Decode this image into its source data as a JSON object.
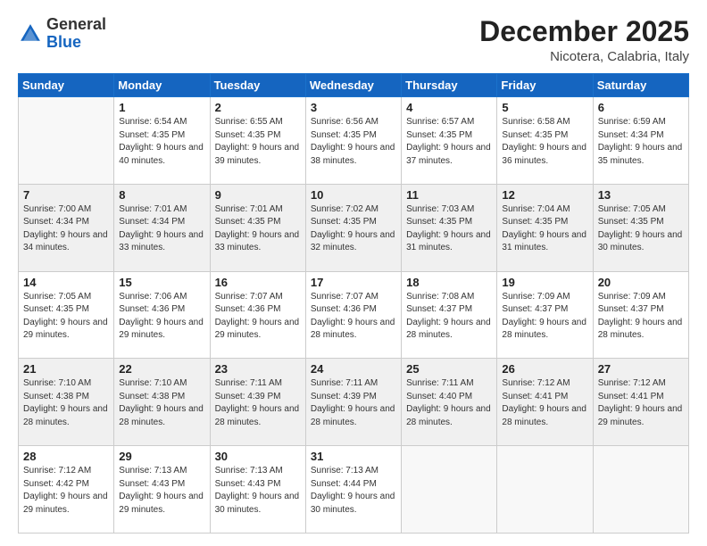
{
  "header": {
    "logo_general": "General",
    "logo_blue": "Blue",
    "month_title": "December 2025",
    "location": "Nicotera, Calabria, Italy"
  },
  "weekdays": [
    "Sunday",
    "Monday",
    "Tuesday",
    "Wednesday",
    "Thursday",
    "Friday",
    "Saturday"
  ],
  "weeks": [
    [
      {
        "day": "",
        "sunrise": "",
        "sunset": "",
        "daylight": ""
      },
      {
        "day": "1",
        "sunrise": "Sunrise: 6:54 AM",
        "sunset": "Sunset: 4:35 PM",
        "daylight": "Daylight: 9 hours and 40 minutes."
      },
      {
        "day": "2",
        "sunrise": "Sunrise: 6:55 AM",
        "sunset": "Sunset: 4:35 PM",
        "daylight": "Daylight: 9 hours and 39 minutes."
      },
      {
        "day": "3",
        "sunrise": "Sunrise: 6:56 AM",
        "sunset": "Sunset: 4:35 PM",
        "daylight": "Daylight: 9 hours and 38 minutes."
      },
      {
        "day": "4",
        "sunrise": "Sunrise: 6:57 AM",
        "sunset": "Sunset: 4:35 PM",
        "daylight": "Daylight: 9 hours and 37 minutes."
      },
      {
        "day": "5",
        "sunrise": "Sunrise: 6:58 AM",
        "sunset": "Sunset: 4:35 PM",
        "daylight": "Daylight: 9 hours and 36 minutes."
      },
      {
        "day": "6",
        "sunrise": "Sunrise: 6:59 AM",
        "sunset": "Sunset: 4:34 PM",
        "daylight": "Daylight: 9 hours and 35 minutes."
      }
    ],
    [
      {
        "day": "7",
        "sunrise": "Sunrise: 7:00 AM",
        "sunset": "Sunset: 4:34 PM",
        "daylight": "Daylight: 9 hours and 34 minutes."
      },
      {
        "day": "8",
        "sunrise": "Sunrise: 7:01 AM",
        "sunset": "Sunset: 4:34 PM",
        "daylight": "Daylight: 9 hours and 33 minutes."
      },
      {
        "day": "9",
        "sunrise": "Sunrise: 7:01 AM",
        "sunset": "Sunset: 4:35 PM",
        "daylight": "Daylight: 9 hours and 33 minutes."
      },
      {
        "day": "10",
        "sunrise": "Sunrise: 7:02 AM",
        "sunset": "Sunset: 4:35 PM",
        "daylight": "Daylight: 9 hours and 32 minutes."
      },
      {
        "day": "11",
        "sunrise": "Sunrise: 7:03 AM",
        "sunset": "Sunset: 4:35 PM",
        "daylight": "Daylight: 9 hours and 31 minutes."
      },
      {
        "day": "12",
        "sunrise": "Sunrise: 7:04 AM",
        "sunset": "Sunset: 4:35 PM",
        "daylight": "Daylight: 9 hours and 31 minutes."
      },
      {
        "day": "13",
        "sunrise": "Sunrise: 7:05 AM",
        "sunset": "Sunset: 4:35 PM",
        "daylight": "Daylight: 9 hours and 30 minutes."
      }
    ],
    [
      {
        "day": "14",
        "sunrise": "Sunrise: 7:05 AM",
        "sunset": "Sunset: 4:35 PM",
        "daylight": "Daylight: 9 hours and 29 minutes."
      },
      {
        "day": "15",
        "sunrise": "Sunrise: 7:06 AM",
        "sunset": "Sunset: 4:36 PM",
        "daylight": "Daylight: 9 hours and 29 minutes."
      },
      {
        "day": "16",
        "sunrise": "Sunrise: 7:07 AM",
        "sunset": "Sunset: 4:36 PM",
        "daylight": "Daylight: 9 hours and 29 minutes."
      },
      {
        "day": "17",
        "sunrise": "Sunrise: 7:07 AM",
        "sunset": "Sunset: 4:36 PM",
        "daylight": "Daylight: 9 hours and 28 minutes."
      },
      {
        "day": "18",
        "sunrise": "Sunrise: 7:08 AM",
        "sunset": "Sunset: 4:37 PM",
        "daylight": "Daylight: 9 hours and 28 minutes."
      },
      {
        "day": "19",
        "sunrise": "Sunrise: 7:09 AM",
        "sunset": "Sunset: 4:37 PM",
        "daylight": "Daylight: 9 hours and 28 minutes."
      },
      {
        "day": "20",
        "sunrise": "Sunrise: 7:09 AM",
        "sunset": "Sunset: 4:37 PM",
        "daylight": "Daylight: 9 hours and 28 minutes."
      }
    ],
    [
      {
        "day": "21",
        "sunrise": "Sunrise: 7:10 AM",
        "sunset": "Sunset: 4:38 PM",
        "daylight": "Daylight: 9 hours and 28 minutes."
      },
      {
        "day": "22",
        "sunrise": "Sunrise: 7:10 AM",
        "sunset": "Sunset: 4:38 PM",
        "daylight": "Daylight: 9 hours and 28 minutes."
      },
      {
        "day": "23",
        "sunrise": "Sunrise: 7:11 AM",
        "sunset": "Sunset: 4:39 PM",
        "daylight": "Daylight: 9 hours and 28 minutes."
      },
      {
        "day": "24",
        "sunrise": "Sunrise: 7:11 AM",
        "sunset": "Sunset: 4:39 PM",
        "daylight": "Daylight: 9 hours and 28 minutes."
      },
      {
        "day": "25",
        "sunrise": "Sunrise: 7:11 AM",
        "sunset": "Sunset: 4:40 PM",
        "daylight": "Daylight: 9 hours and 28 minutes."
      },
      {
        "day": "26",
        "sunrise": "Sunrise: 7:12 AM",
        "sunset": "Sunset: 4:41 PM",
        "daylight": "Daylight: 9 hours and 28 minutes."
      },
      {
        "day": "27",
        "sunrise": "Sunrise: 7:12 AM",
        "sunset": "Sunset: 4:41 PM",
        "daylight": "Daylight: 9 hours and 29 minutes."
      }
    ],
    [
      {
        "day": "28",
        "sunrise": "Sunrise: 7:12 AM",
        "sunset": "Sunset: 4:42 PM",
        "daylight": "Daylight: 9 hours and 29 minutes."
      },
      {
        "day": "29",
        "sunrise": "Sunrise: 7:13 AM",
        "sunset": "Sunset: 4:43 PM",
        "daylight": "Daylight: 9 hours and 29 minutes."
      },
      {
        "day": "30",
        "sunrise": "Sunrise: 7:13 AM",
        "sunset": "Sunset: 4:43 PM",
        "daylight": "Daylight: 9 hours and 30 minutes."
      },
      {
        "day": "31",
        "sunrise": "Sunrise: 7:13 AM",
        "sunset": "Sunset: 4:44 PM",
        "daylight": "Daylight: 9 hours and 30 minutes."
      },
      {
        "day": "",
        "sunrise": "",
        "sunset": "",
        "daylight": ""
      },
      {
        "day": "",
        "sunrise": "",
        "sunset": "",
        "daylight": ""
      },
      {
        "day": "",
        "sunrise": "",
        "sunset": "",
        "daylight": ""
      }
    ]
  ]
}
